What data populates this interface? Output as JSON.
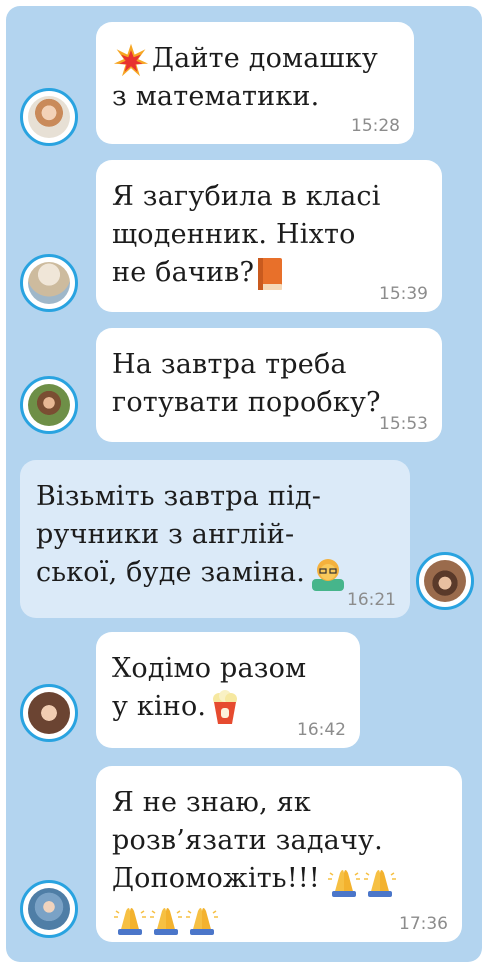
{
  "messages": [
    {
      "text": "Дайте домашку\nз математики.",
      "time": "15:28",
      "emoji": "collision-icon",
      "avatar": "girl-avatar-1"
    },
    {
      "text": "Я загубила в класі\nщоденник. Ніхто\nне бачив?",
      "time": "15:39",
      "emoji": "orange-book-icon",
      "avatar": "girl-avatar-2"
    },
    {
      "text": "На завтра треба\nготувати поробку?",
      "time": "15:53",
      "avatar": "girl-avatar-3"
    },
    {
      "text": "Візьміть завтра під-\nручники з англій-\nської, буде заміна.",
      "time": "16:21",
      "emoji": "teacher-icon",
      "avatar": "teacher-avatar",
      "outgoing": true
    },
    {
      "text": "Ходімо разом\nу кіно.",
      "time": "16:42",
      "emoji": "popcorn-icon",
      "avatar": "girl-avatar-4"
    },
    {
      "text": "Я не знаю, як\nрозв’язати задачу.\nДопоможіть!!!",
      "time": "17:36",
      "emoji": "folded-hands-icon",
      "avatar": "boy-avatar"
    }
  ],
  "colors": {
    "background": "#b3d4ef",
    "incoming": "#ffffff",
    "outgoing": "#dbeaf8",
    "avatar_ring": "#29a3e0"
  }
}
